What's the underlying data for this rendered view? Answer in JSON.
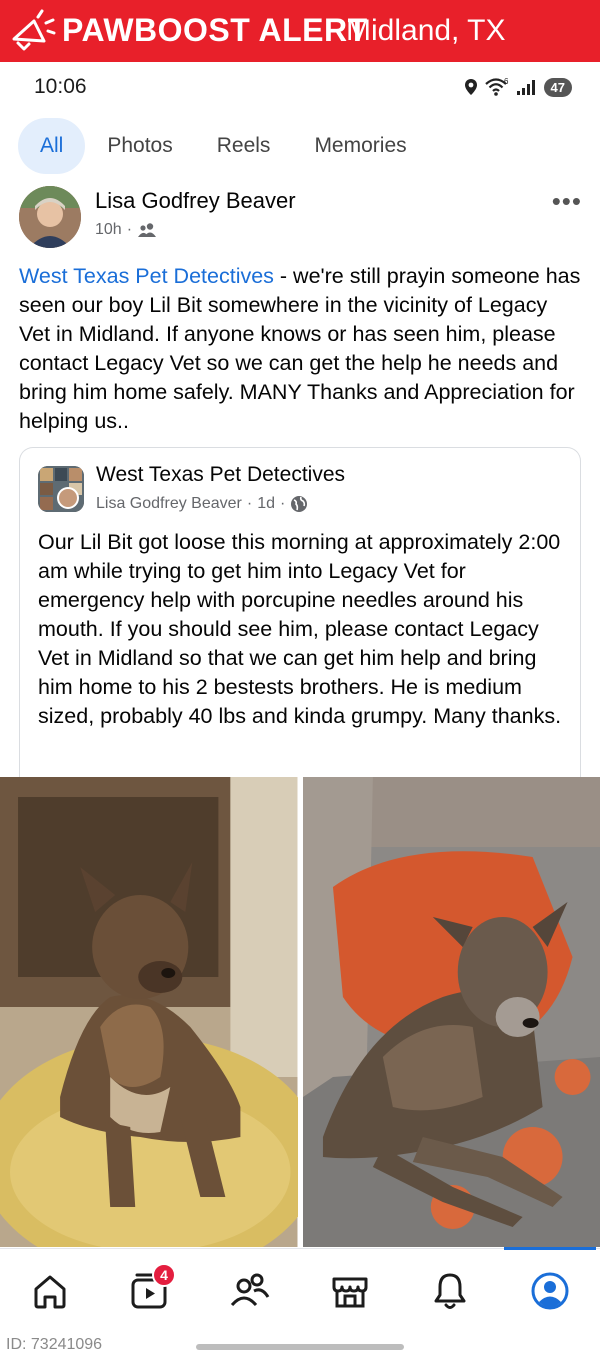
{
  "alert": {
    "brand": "PAWBOOST ALERT",
    "location": "Midland, TX",
    "color": "#e8202a",
    "icon": "megaphone-icon"
  },
  "status_bar": {
    "time": "10:06",
    "wifi_label": "6",
    "battery": "47"
  },
  "tabs": [
    {
      "label": "All",
      "active": true
    },
    {
      "label": "Photos",
      "active": false
    },
    {
      "label": "Reels",
      "active": false
    },
    {
      "label": "Memories",
      "active": false
    }
  ],
  "post": {
    "author": "Lisa Godfrey Beaver",
    "time": "10h",
    "audience_icon": "friends-icon",
    "page_link": "West Texas Pet Detectives",
    "text": " - we're still prayin someone has seen our boy Lil Bit somewhere in the vicinity of Legacy Vet in Midland. If anyone knows or has seen him, please contact Legacy Vet so we can get the help he needs and bring him home safely.  MANY Thanks and Appreciation for helping us.."
  },
  "shared_post": {
    "page_name": "West Texas Pet Detectives",
    "author": "Lisa Godfrey Beaver",
    "time": "1d",
    "audience_icon": "globe-icon",
    "text": "Our Lil Bit got loose this morning at approximately 2:00 am while trying to get him into Legacy Vet for emergency help with porcupine needles around his mouth.  If you should see him, please contact Legacy Vet in Midland so that we can get him help and bring him home to his 2 bestests brothers.  He is medium sized, probably 40 lbs and kinda grumpy. Many thanks."
  },
  "bottom_nav": {
    "items": [
      "home-icon",
      "video-icon",
      "friends-icon",
      "marketplace-icon",
      "notifications-icon",
      "profile-icon"
    ],
    "video_badge": "4",
    "active": "profile-icon",
    "accent": "#1a6ed8"
  },
  "footer": {
    "id_text": "ID: 73241096"
  }
}
